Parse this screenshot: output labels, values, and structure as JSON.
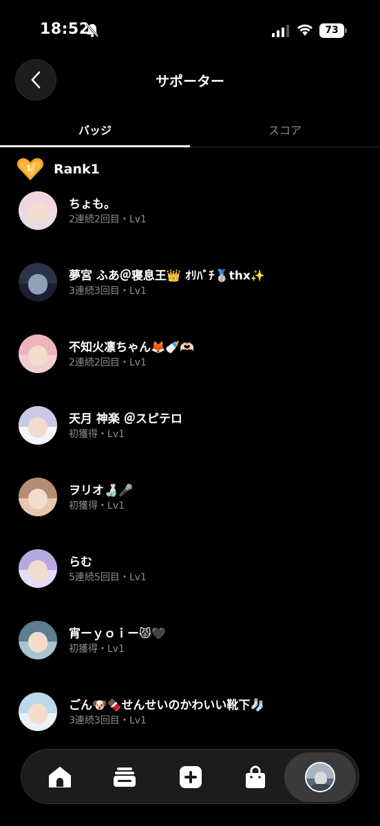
{
  "status_bar": {
    "time": "18:52",
    "battery": "73"
  },
  "header": {
    "title": "サポーター"
  },
  "tabs": [
    {
      "label": "バッジ",
      "active": true
    },
    {
      "label": "スコア",
      "active": false
    }
  ],
  "rank": {
    "label": "Rank1",
    "badge_icon": "heart-badge-icon",
    "badge_color": "#f5a623"
  },
  "supporters": [
    {
      "name": "ちょも。",
      "sub": "2連続2回目・Lv1",
      "avatar_colors": [
        "#f1d5de",
        "#d9c2cf"
      ]
    },
    {
      "name": "夢宮 ふあ＠寝息王👑 ｵﾘﾊﾞﾁ🥈thx✨",
      "sub": "3連続3回目・Lv1",
      "avatar_colors": [
        "#2a3448",
        "#1a2030"
      ]
    },
    {
      "name": "不知火凛ちゃん🦊🍼🫶🏻",
      "sub": "2連続2回目・Lv1",
      "avatar_colors": [
        "#ecb4bb",
        "#d98c99"
      ]
    },
    {
      "name": "天月 神楽 ＠スピテロ",
      "sub": "初獲得・Lv1",
      "avatar_colors": [
        "#c9c9e8",
        "#f5f5ff"
      ]
    },
    {
      "name": "ヲリオ🍶🎤",
      "sub": "初獲得・Lv1",
      "avatar_colors": [
        "#b58d72",
        "#e8c8ad"
      ]
    },
    {
      "name": "らむ",
      "sub": "5連続5回目・Lv1",
      "avatar_colors": [
        "#b8a8e0",
        "#e6dcf7"
      ]
    },
    {
      "name": "宵ーｙｏｉー😾🖤",
      "sub": "初獲得・Lv1",
      "avatar_colors": [
        "#5e7d8f",
        "#a8c4d1"
      ]
    },
    {
      "name": "ごん🐶🍫せんせいのかわいい靴下🧦",
      "sub": "3連続3回目・Lv1",
      "avatar_colors": [
        "#bcd8ea",
        "#e8f2f8"
      ]
    }
  ],
  "nav": {
    "items": [
      "home-icon",
      "feed-icon",
      "add-icon",
      "shop-icon",
      "profile-avatar"
    ]
  }
}
